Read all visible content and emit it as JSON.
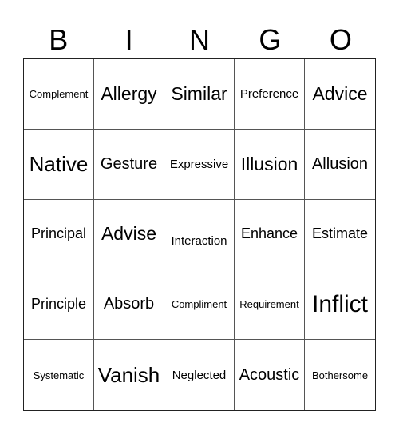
{
  "header": [
    "B",
    "I",
    "N",
    "G",
    "O"
  ],
  "rows": [
    [
      "Complement",
      "Allergy",
      "Similar",
      "Preference",
      "Advice"
    ],
    [
      "Native",
      "Gesture",
      "Expressive",
      "Illusion",
      "Allusion"
    ],
    [
      "Principal",
      "Advise",
      "Interaction",
      "Enhance",
      "Estimate"
    ],
    [
      "Principle",
      "Absorb",
      "Compliment",
      "Requirement",
      "Inflict"
    ],
    [
      "Systematic",
      "Vanish",
      "Neglected",
      "Acoustic",
      "Bothersome"
    ]
  ]
}
